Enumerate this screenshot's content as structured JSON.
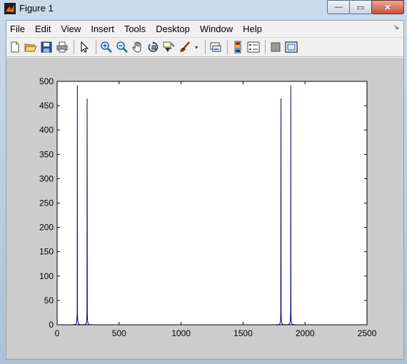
{
  "window": {
    "title": "Figure 1",
    "minimize_glyph": "—",
    "maximize_glyph": "▭",
    "close_glyph": "✕"
  },
  "menu": {
    "items": [
      "File",
      "Edit",
      "View",
      "Insert",
      "Tools",
      "Desktop",
      "Window",
      "Help"
    ],
    "dock_glyph": "↘"
  },
  "toolbar": {
    "buttons": [
      {
        "icon": "new-figure-icon"
      },
      {
        "icon": "open-file-icon"
      },
      {
        "icon": "save-icon"
      },
      {
        "icon": "print-icon"
      },
      {
        "icon": "pointer-arrow-icon"
      },
      {
        "icon": "zoom-in-icon"
      },
      {
        "icon": "zoom-out-icon"
      },
      {
        "icon": "pan-hand-icon"
      },
      {
        "icon": "rotate-3d-icon"
      },
      {
        "icon": "data-cursor-icon"
      },
      {
        "icon": "brush-icon"
      },
      {
        "icon": "link-plot-icon"
      },
      {
        "icon": "colorbar-icon"
      },
      {
        "icon": "legend-icon"
      },
      {
        "icon": "hide-plot-tools-icon"
      },
      {
        "icon": "show-plot-tools-icon"
      }
    ],
    "dropdown_glyph": "▾"
  },
  "colors": {
    "line": "#00007f",
    "figure_bg": "#cccccc",
    "axes_bg": "#ffffff"
  },
  "chart_data": {
    "type": "line",
    "title": "",
    "xlabel": "",
    "ylabel": "",
    "xlim": [
      0,
      2500
    ],
    "ylim": [
      0,
      500
    ],
    "xticks": [
      0,
      500,
      1000,
      1500,
      2000,
      2500
    ],
    "yticks": [
      0,
      50,
      100,
      150,
      200,
      250,
      300,
      350,
      400,
      450,
      500
    ],
    "grid": false,
    "series": [
      {
        "peaks": [
          {
            "x": 163,
            "y": 492,
            "base": 30
          },
          {
            "x": 242,
            "y": 465,
            "base": 28
          },
          {
            "x": 243,
            "y": 275,
            "base": 20
          },
          {
            "x": 1805,
            "y": 275,
            "base": 20
          },
          {
            "x": 1806,
            "y": 465,
            "base": 28
          },
          {
            "x": 1885,
            "y": 492,
            "base": 30
          },
          {
            "x": 1886,
            "y": 55,
            "base": 10
          }
        ],
        "baseline": 0
      }
    ]
  }
}
